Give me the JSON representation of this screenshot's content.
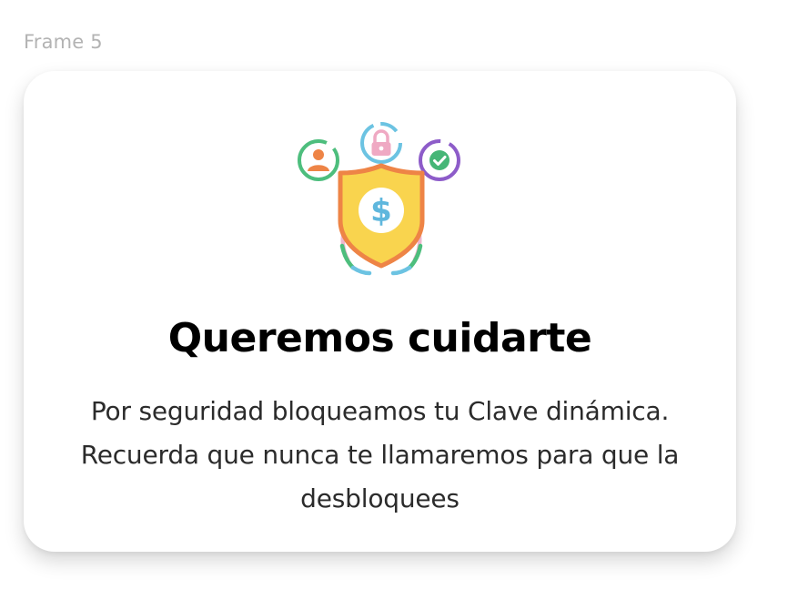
{
  "frame": {
    "label": "Frame 5"
  },
  "card": {
    "title": "Queremos cuidarte",
    "message_line_1": "Por seguridad bloqueamos tu Clave dinámica.",
    "message_line_2": "Recuerda que nunca te llamaremos para que la",
    "message_line_3": "desbloquees"
  },
  "illustration": {
    "icons": [
      "user-icon",
      "lock-icon",
      "check-icon",
      "shield-icon",
      "dollar-icon"
    ],
    "colors": {
      "shield_fill": "#F9D44E",
      "shield_stroke": "#EE8446",
      "dollar": "#5FB7DD",
      "user_ring": "#4DBE7D",
      "user_figure": "#EE8446",
      "lock_ring": "#6CC3E2",
      "lock": "#EFA9C3",
      "check_ring": "#8D5CC9",
      "check": "#46B677",
      "arc_pink": "#EFB6CE",
      "arc_green": "#4DBE7D",
      "arc_blue": "#6CC3E2"
    }
  }
}
